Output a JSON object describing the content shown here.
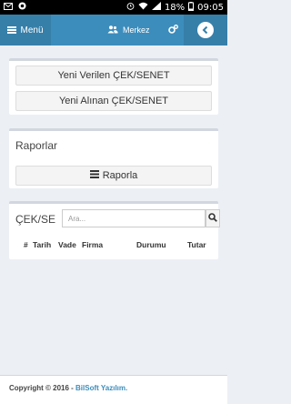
{
  "statusbar": {
    "battery": "18%",
    "time": "09:05"
  },
  "header": {
    "menu_label": "Menü",
    "branch_label": "Merkez"
  },
  "actions": {
    "new_given": "Yeni Verilen ÇEK/SENET",
    "new_received": "Yeni Alınan ÇEK/SENET"
  },
  "reports": {
    "title": "Raporlar",
    "report_button": "Raporla"
  },
  "checks": {
    "title": "ÇEK/SENET",
    "search_placeholder": "Ara...",
    "columns": [
      "#",
      "Tarih",
      "Vade",
      "Firma",
      "Durumu",
      "Tutar"
    ]
  },
  "footer": {
    "prefix": "Copyright © 2016 - ",
    "brand": "BilSoft Yazılım."
  },
  "colors": {
    "primary": "#3c8dbc",
    "primary_dark": "#367fa9",
    "background": "#ecf0f5"
  }
}
